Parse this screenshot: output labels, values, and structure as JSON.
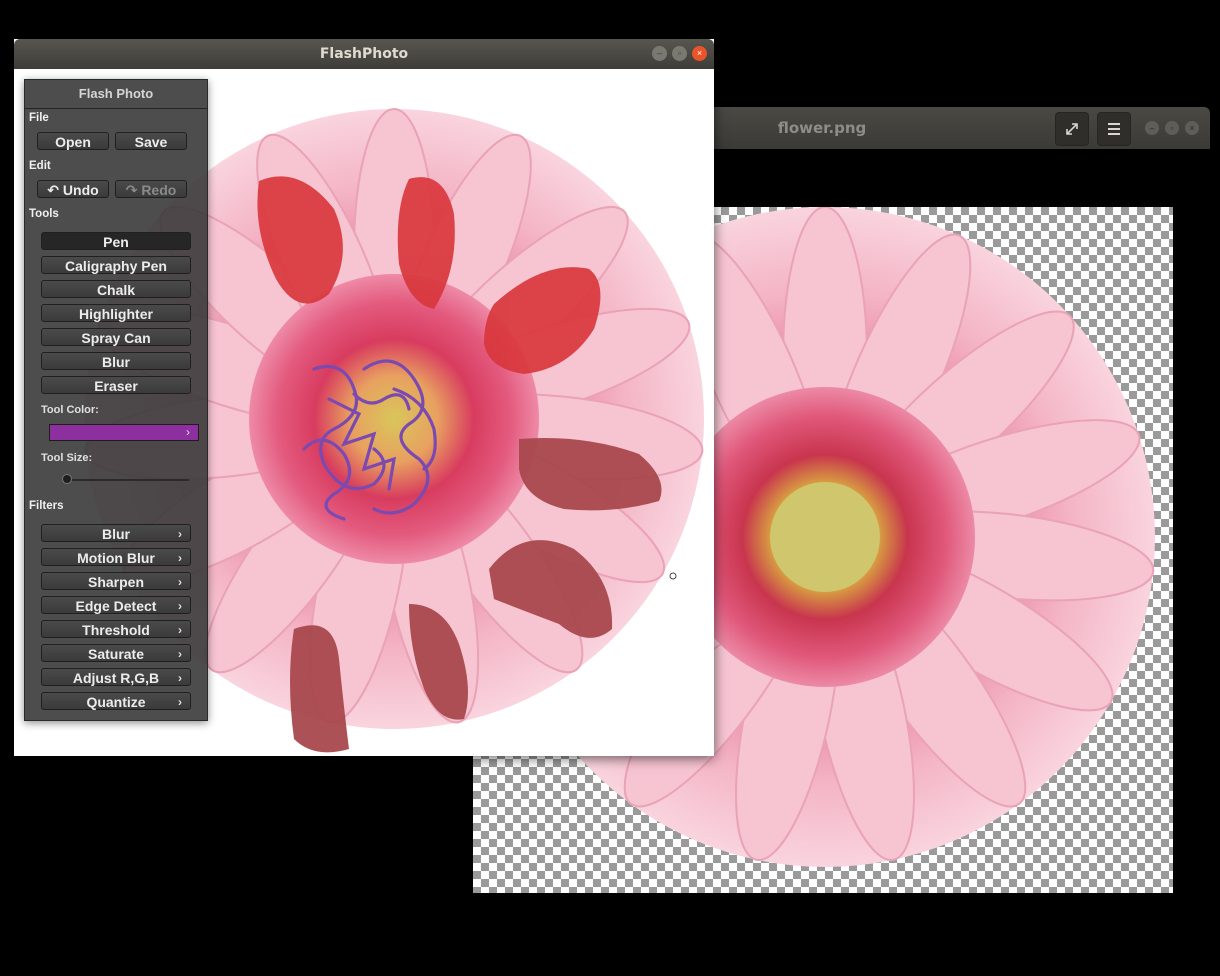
{
  "viewer": {
    "title": "flower.png",
    "fullscreen_icon": "fullscreen-icon",
    "menu_icon": "hamburger-menu-icon"
  },
  "flash": {
    "title": "FlashPhoto"
  },
  "panel": {
    "title": "Flash Photo",
    "file_label": "File",
    "open_label": "Open",
    "save_label": "Save",
    "edit_label": "Edit",
    "undo_label": "Undo",
    "redo_label": "Redo",
    "tools_label": "Tools",
    "tools": [
      {
        "label": "Pen",
        "active": true
      },
      {
        "label": "Caligraphy Pen"
      },
      {
        "label": "Chalk"
      },
      {
        "label": "Highlighter"
      },
      {
        "label": "Spray Can"
      },
      {
        "label": "Blur"
      },
      {
        "label": "Eraser"
      }
    ],
    "tool_color_label": "Tool Color:",
    "tool_color": "#8e2fa0",
    "tool_size_label": "Tool Size:",
    "tool_size": 0.02,
    "filters_label": "Filters",
    "filters": [
      "Blur",
      "Motion Blur",
      "Sharpen",
      "Edge Detect",
      "Threshold",
      "Saturate",
      "Adjust R,G,B",
      "Quantize"
    ]
  },
  "colors": {
    "petal": "#f2b4c4",
    "center": "#e2496f",
    "red_paint": "#d9373c",
    "brown_paint": "#a8484d",
    "purple_pen": "#7b4ab0"
  }
}
